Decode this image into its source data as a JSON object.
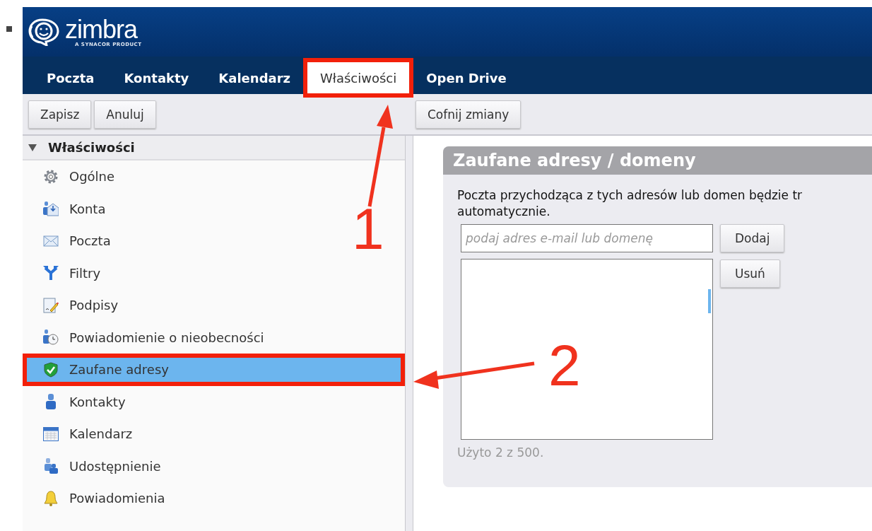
{
  "logo": {
    "name": "zimbra",
    "tagline": "A SYNACOR PRODUCT"
  },
  "tabs": [
    {
      "label": "Poczta",
      "selected": false,
      "highlighted": false
    },
    {
      "label": "Kontakty",
      "selected": false,
      "highlighted": false
    },
    {
      "label": "Kalendarz",
      "selected": false,
      "highlighted": false
    },
    {
      "label": "Właściwości",
      "selected": true,
      "highlighted": true
    },
    {
      "label": "Open Drive",
      "selected": false,
      "highlighted": false
    }
  ],
  "toolbar": {
    "left_buttons": [
      "Zapisz",
      "Anuluj"
    ],
    "right_buttons": [
      "Cofnij zmiany"
    ]
  },
  "sidebar": {
    "title": "Właściwości",
    "expanded": true,
    "items": [
      {
        "label": "Ogólne",
        "selected": false,
        "highlighted": false
      },
      {
        "label": "Konta",
        "selected": false,
        "highlighted": false
      },
      {
        "label": "Poczta",
        "selected": false,
        "highlighted": false
      },
      {
        "label": "Filtry",
        "selected": false,
        "highlighted": false
      },
      {
        "label": "Podpisy",
        "selected": false,
        "highlighted": false
      },
      {
        "label": "Powiadomienie o nieobecności",
        "selected": false,
        "highlighted": false
      },
      {
        "label": "Zaufane adresy",
        "selected": true,
        "highlighted": true
      },
      {
        "label": "Kontakty",
        "selected": false,
        "highlighted": false
      },
      {
        "label": "Kalendarz",
        "selected": false,
        "highlighted": false
      },
      {
        "label": "Udostępnienie",
        "selected": false,
        "highlighted": false
      },
      {
        "label": "Powiadomienia",
        "selected": false,
        "highlighted": false
      }
    ]
  },
  "panel": {
    "title": "Zaufane adresy / domeny",
    "description_lines": [
      "Poczta przychodząca z tych adresów lub domen będzie tr",
      "automatycznie."
    ],
    "input": {
      "placeholder": "podaj adres e-mail lub domenę"
    },
    "add_button": "Dodaj",
    "remove_button": "Usuń",
    "usage": "Użyto 2 z 500."
  },
  "annotations": [
    {
      "label": "1"
    },
    {
      "label": "2"
    }
  ]
}
